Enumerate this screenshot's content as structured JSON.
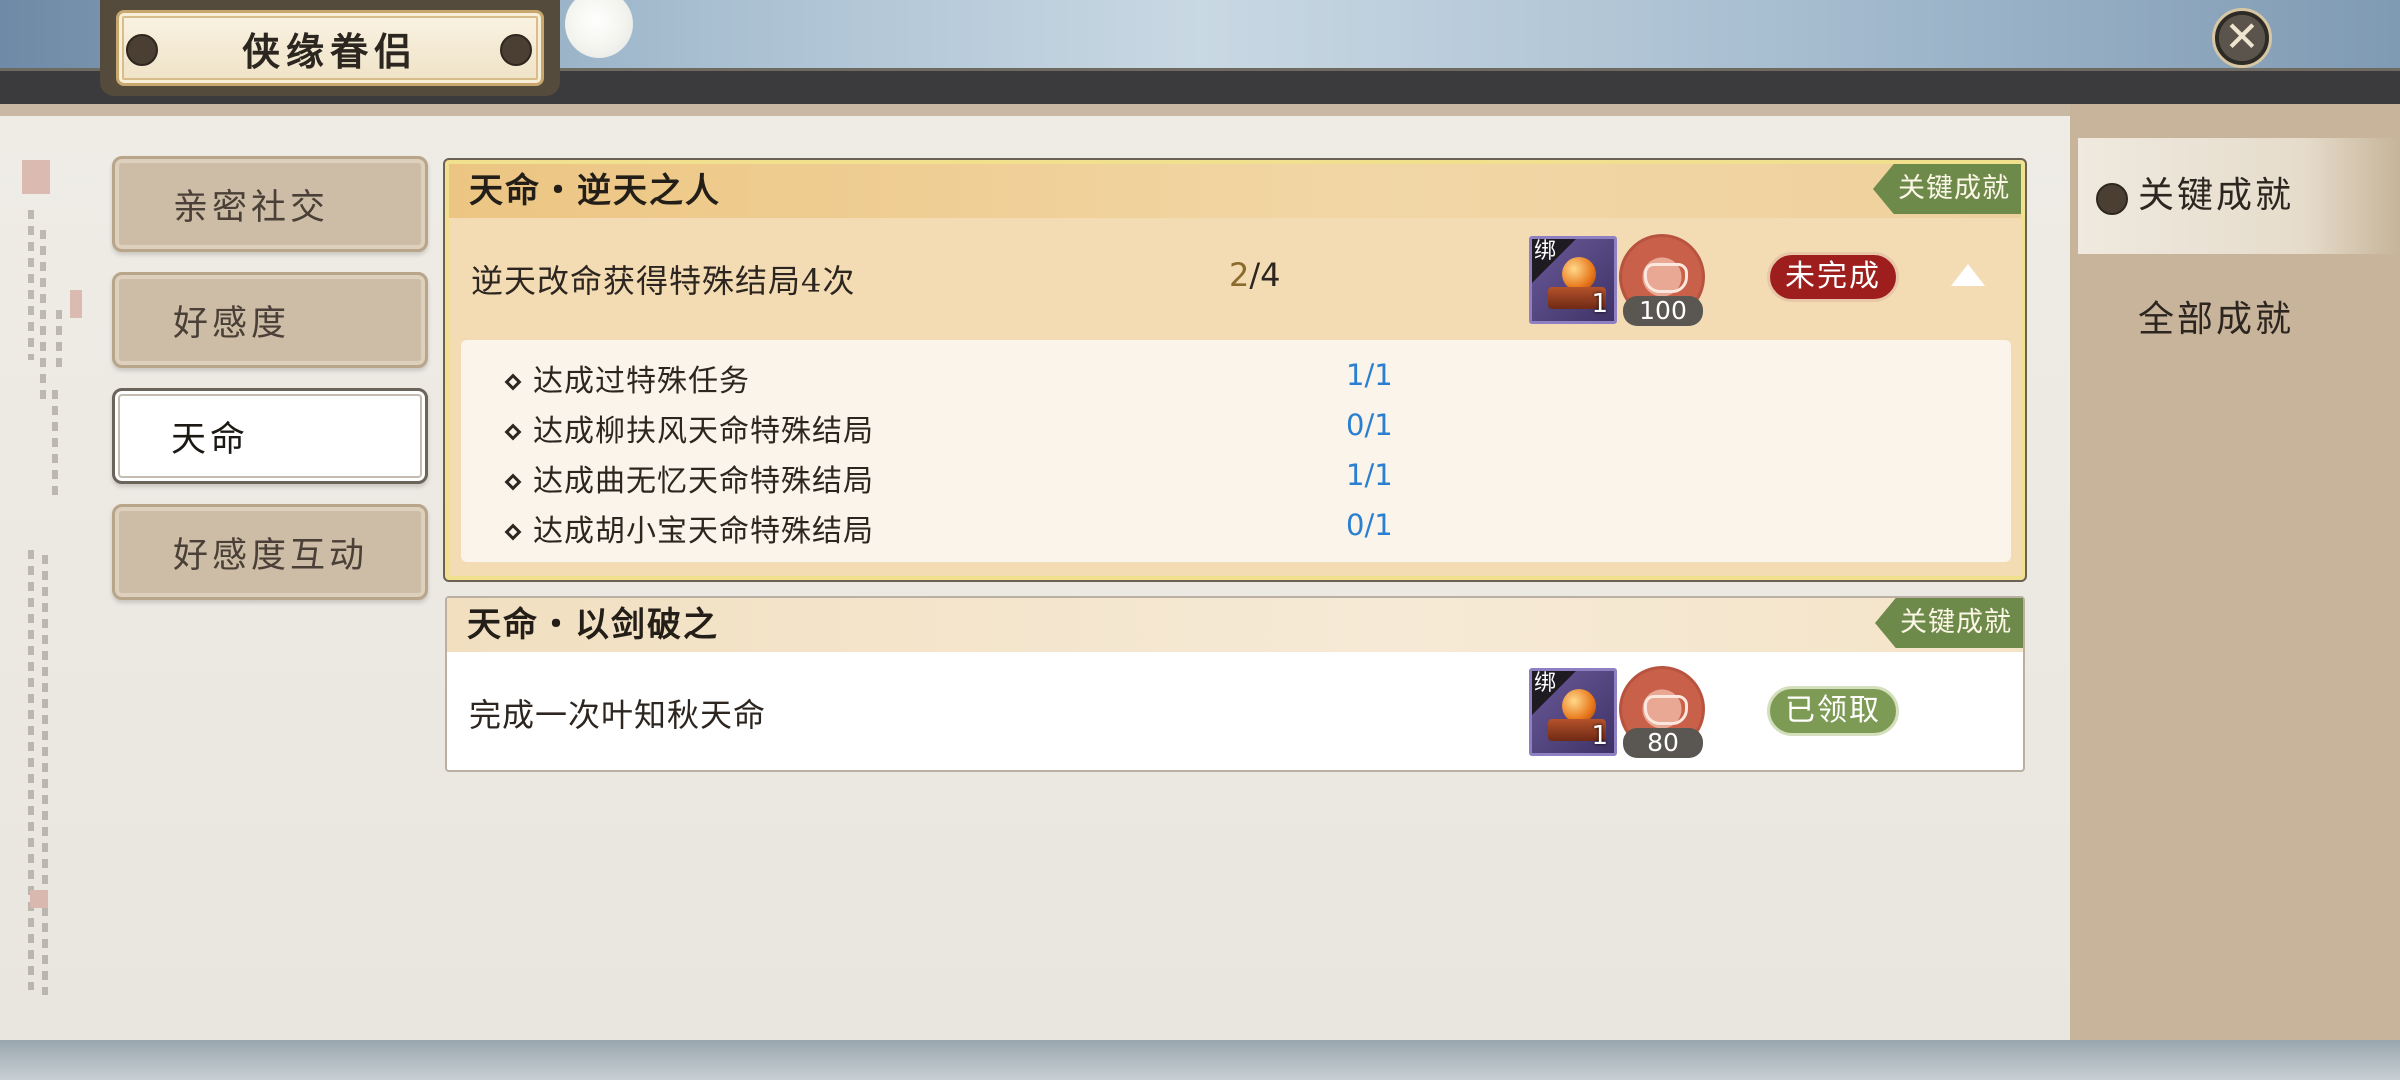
{
  "header": {
    "title": "侠缘眷侣",
    "close_icon": "close-icon"
  },
  "left_nav": {
    "items": [
      {
        "label": "亲密社交",
        "active": false
      },
      {
        "label": "好感度",
        "active": false
      },
      {
        "label": "天命",
        "active": true
      },
      {
        "label": "好感度互动",
        "active": false
      }
    ]
  },
  "right_nav": {
    "items": [
      {
        "label": "关键成就",
        "active": true
      },
      {
        "label": "全部成就",
        "active": false
      }
    ]
  },
  "achievements": [
    {
      "title": "天命・逆天之人",
      "badge": "关键成就",
      "task": "逆天改命获得特殊结局4次",
      "progress_current": "2",
      "progress_total": "/4",
      "reward_item": {
        "tag": "绑",
        "quantity": "1",
        "icon": "orb-on-pedestal-icon"
      },
      "reward_points": "100",
      "status": "未完成",
      "expanded": true,
      "subtasks": [
        {
          "label": "达成过特殊任务",
          "progress": "1/1"
        },
        {
          "label": "达成柳扶风天命特殊结局",
          "progress": "0/1"
        },
        {
          "label": "达成曲无忆天命特殊结局",
          "progress": "1/1"
        },
        {
          "label": "达成胡小宝天命特殊结局",
          "progress": "0/1"
        }
      ]
    },
    {
      "title": "天命・以剑破之",
      "badge": "关键成就",
      "task": "完成一次叶知秋天命",
      "reward_item": {
        "tag": "绑",
        "quantity": "1",
        "icon": "orb-on-pedestal-icon"
      },
      "reward_points": "80",
      "status": "已领取",
      "expanded": false
    }
  ],
  "colors": {
    "incomplete": "#9e1e1e",
    "claimed": "#7d9b54",
    "badge": "#6e8a4a",
    "sub_progress": "#2a7fd0"
  }
}
